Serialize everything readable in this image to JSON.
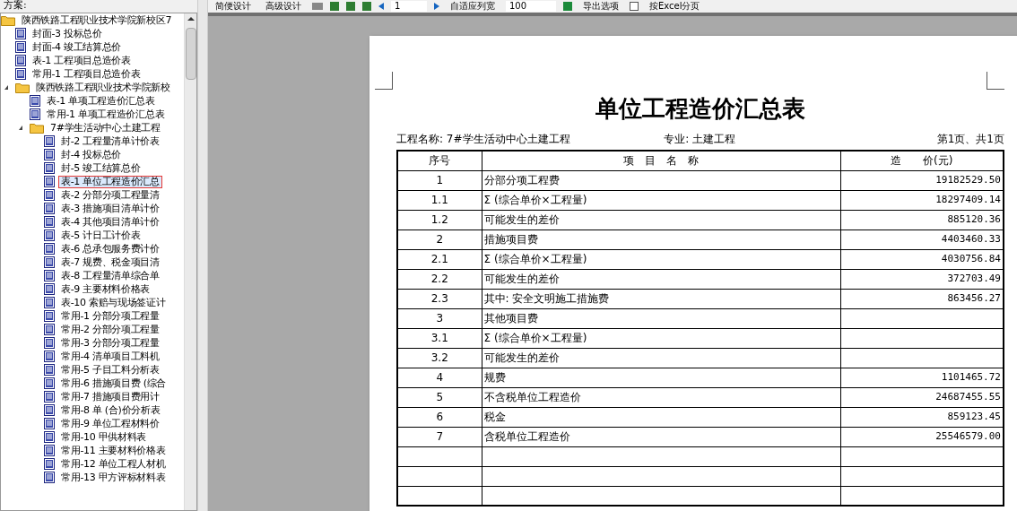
{
  "sidebar": {
    "label": "方案:",
    "tree": [
      {
        "label": "陕西铁路工程职业技术学院新校区7",
        "kind": "folder",
        "selected": false,
        "children": [
          {
            "label": "封面-3 投标总价",
            "kind": "report",
            "selected": false
          },
          {
            "label": "封面-4 竣工结算总价",
            "kind": "report",
            "selected": false
          },
          {
            "label": "表-1 工程项目总造价表",
            "kind": "report",
            "selected": false
          },
          {
            "label": "常用-1 工程项目总造价表",
            "kind": "report",
            "selected": false
          },
          {
            "label": "陕西铁路工程职业技术学院新校",
            "kind": "folder",
            "expanded": true,
            "selected": false,
            "children": [
              {
                "label": "表-1 单项工程造价汇总表",
                "kind": "report",
                "selected": false
              },
              {
                "label": "常用-1 单项工程造价汇总表",
                "kind": "report",
                "selected": false
              },
              {
                "label": "7#学生活动中心土建工程",
                "kind": "folder",
                "expanded": true,
                "selected": false,
                "children": [
                  {
                    "label": "封-2 工程量清单计价表",
                    "kind": "report",
                    "selected": false
                  },
                  {
                    "label": "封-4 投标总价",
                    "kind": "report",
                    "selected": false
                  },
                  {
                    "label": "封-5 竣工结算总价",
                    "kind": "report",
                    "selected": false
                  },
                  {
                    "label": "表-1 单位工程造价汇总",
                    "kind": "report",
                    "selected": true
                  },
                  {
                    "label": "表-2 分部分项工程量清",
                    "kind": "report",
                    "selected": false
                  },
                  {
                    "label": "表-3 措施项目清单计价",
                    "kind": "report",
                    "selected": false
                  },
                  {
                    "label": "表-4 其他项目清单计价",
                    "kind": "report",
                    "selected": false
                  },
                  {
                    "label": "表-5 计日工计价表",
                    "kind": "report",
                    "selected": false
                  },
                  {
                    "label": "表-6 总承包服务费计价",
                    "kind": "report",
                    "selected": false
                  },
                  {
                    "label": "表-7 规费、税金项目清",
                    "kind": "report",
                    "selected": false
                  },
                  {
                    "label": "表-8 工程量清单综合单",
                    "kind": "report",
                    "selected": false
                  },
                  {
                    "label": "表-9 主要材料价格表",
                    "kind": "report",
                    "selected": false
                  },
                  {
                    "label": "表-10 索赔与现场签证计",
                    "kind": "report",
                    "selected": false
                  },
                  {
                    "label": "常用-1 分部分项工程量",
                    "kind": "report",
                    "selected": false
                  },
                  {
                    "label": "常用-2 分部分项工程量",
                    "kind": "report",
                    "selected": false
                  },
                  {
                    "label": "常用-3 分部分项工程量",
                    "kind": "report",
                    "selected": false
                  },
                  {
                    "label": "常用-4 清单项目工料机",
                    "kind": "report",
                    "selected": false
                  },
                  {
                    "label": "常用-5 子目工料分析表",
                    "kind": "report",
                    "selected": false
                  },
                  {
                    "label": "常用-6 措施项目费 (综合",
                    "kind": "report",
                    "selected": false
                  },
                  {
                    "label": "常用-7 措施项目费用计",
                    "kind": "report",
                    "selected": false
                  },
                  {
                    "label": "常用-8 单 (合)价分析表",
                    "kind": "report",
                    "selected": false
                  },
                  {
                    "label": "常用-9 单位工程材料价",
                    "kind": "report",
                    "selected": false
                  },
                  {
                    "label": "常用-10 甲供材料表",
                    "kind": "report",
                    "selected": false
                  },
                  {
                    "label": "常用-11 主要材料价格表",
                    "kind": "report",
                    "selected": false
                  },
                  {
                    "label": "常用-12 单位工程人材机",
                    "kind": "report",
                    "selected": false
                  },
                  {
                    "label": "常用-13 甲方评标材料表",
                    "kind": "report",
                    "selected": false
                  }
                ]
              }
            ]
          }
        ]
      }
    ]
  },
  "toolbar": {
    "simple_design": "简便设计",
    "advanced_design": "高级设计",
    "page": "1",
    "fit_width": "自适应列宽",
    "zoom": "100",
    "export_options": "导出选项",
    "excel_paging": "按Excel分页"
  },
  "report": {
    "title": "单位工程造价汇总表",
    "project": "工程名称: 7#学生活动中心土建工程",
    "discipline": "专业: 土建工程",
    "page_info": "第1页、共1页",
    "columns": [
      "序号",
      "项　目　名　称",
      "造　　价(元)"
    ],
    "rows": [
      [
        "1",
        "分部分项工程费",
        "19182529.50"
      ],
      [
        "1.1",
        "Σ (综合单价×工程量)",
        "18297409.14"
      ],
      [
        "1.2",
        "可能发生的差价",
        "885120.36"
      ],
      [
        "2",
        "措施项目费",
        "4403460.33"
      ],
      [
        "2.1",
        "Σ (综合单价×工程量)",
        "4030756.84"
      ],
      [
        "2.2",
        "可能发生的差价",
        "372703.49"
      ],
      [
        "2.3",
        "其中: 安全文明施工措施费",
        "863456.27"
      ],
      [
        "3",
        "其他项目费",
        ""
      ],
      [
        "3.1",
        "Σ (综合单价×工程量)",
        ""
      ],
      [
        "3.2",
        "可能发生的差价",
        ""
      ],
      [
        "4",
        "规费",
        "1101465.72"
      ],
      [
        "5",
        "不含税单位工程造价",
        "24687455.55"
      ],
      [
        "6",
        "税金",
        "859123.45"
      ],
      [
        "7",
        "含税单位工程造价",
        "25546579.00"
      ]
    ]
  }
}
